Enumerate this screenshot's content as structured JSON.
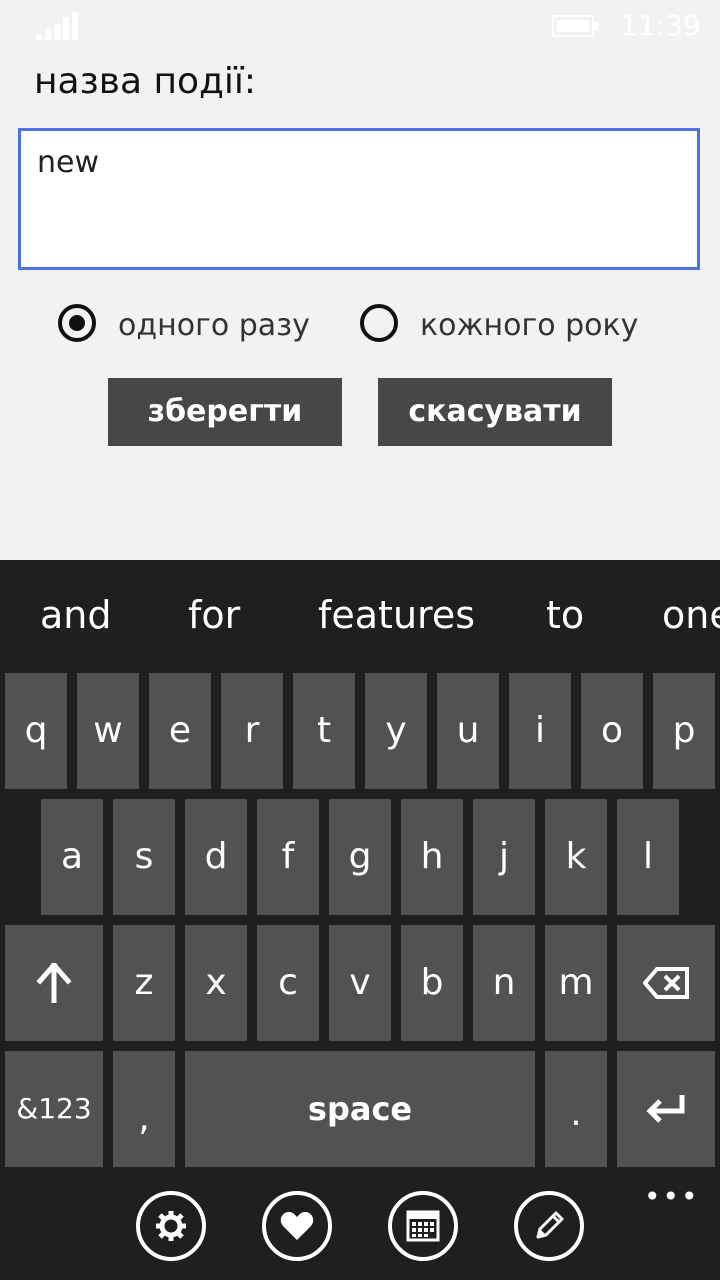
{
  "status": {
    "time": "11:39"
  },
  "form": {
    "title": "назва події:",
    "name_value": "new",
    "radio_once": "одного разу",
    "radio_yearly": "кожного року",
    "save_label": "зберегти",
    "cancel_label": "скасувати"
  },
  "keyboard": {
    "suggestions": [
      "and",
      "for",
      "features",
      "to",
      "one"
    ],
    "row1": [
      "q",
      "w",
      "e",
      "r",
      "t",
      "y",
      "u",
      "i",
      "o",
      "p"
    ],
    "row2": [
      "a",
      "s",
      "d",
      "f",
      "g",
      "h",
      "j",
      "k",
      "l"
    ],
    "row3": [
      "z",
      "x",
      "c",
      "v",
      "b",
      "n",
      "m"
    ],
    "symbols_label": "&123",
    "comma": ",",
    "space_label": "space",
    "period": "."
  },
  "appbar": {
    "more": "•••"
  },
  "colors": {
    "accent": "#4e72e6",
    "button": "#474747",
    "key": "#525252",
    "keyboard_bg": "#1f1f1f"
  },
  "icons": [
    "signal-icon",
    "battery-icon",
    "shift-icon",
    "backspace-icon",
    "enter-icon",
    "settings-icon",
    "favorite-icon",
    "calendar-icon",
    "edit-icon"
  ]
}
